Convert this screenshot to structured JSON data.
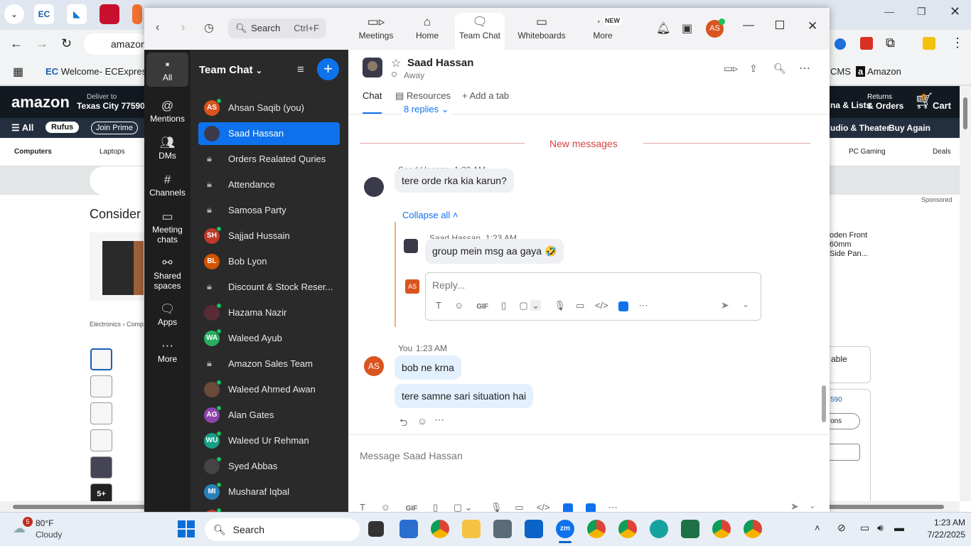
{
  "browser": {
    "address": "amazon",
    "bookmarks": {
      "first": "Welcome- ECExpres",
      "cms": "CMS",
      "amazon": "Amazon"
    },
    "amazon": {
      "logo": "amazon",
      "deliver_line1": "Deliver to",
      "deliver_line2": "Texas City 77590",
      "lists": "na & Lists",
      "returns_l1": "Returns",
      "returns_l2": "& Orders",
      "cart_count": "0",
      "cart": "Cart",
      "all": "All",
      "rufus": "Rufus",
      "join_prime": "Join Prime",
      "audio": "udio & Theater",
      "buy_again": "Buy Again",
      "cat_computers": "Computers",
      "cat_laptops": "Laptops",
      "cat_pcgaming": "PC Gaming",
      "cat_deals": "Deals",
      "consider": "Consider",
      "breadcrumb": "Electronics › Comp",
      "sponsored": "Sponsored",
      "side_prod": "oden Front\n60mm\nSide Pan...",
      "table_text": "able",
      "price_frag": "590",
      "ons": "ons",
      "more_thumbs": "5+"
    }
  },
  "zoom": {
    "search_placeholder": "Search",
    "search_shortcut": "Ctrl+F",
    "nav": [
      {
        "label": "Meetings",
        "icon": "video-icon"
      },
      {
        "label": "Home",
        "icon": "home-icon"
      },
      {
        "label": "Team Chat",
        "icon": "chat-icon"
      },
      {
        "label": "Whiteboards",
        "icon": "whiteboard-icon"
      },
      {
        "label": "More",
        "icon": "more-icon"
      }
    ],
    "new_badge": "NEW",
    "profile_initials": "AS",
    "rail": [
      {
        "label": "All",
        "icon": "chat-bubble-icon"
      },
      {
        "label": "Mentions",
        "icon": "at-icon"
      },
      {
        "label": "DMs",
        "icon": "people-icon"
      },
      {
        "label": "Channels",
        "icon": "hash-icon"
      },
      {
        "label": "Meeting chats",
        "icon": "calendar-icon"
      },
      {
        "label": "Shared spaces",
        "icon": "share-icon"
      },
      {
        "label": "Apps",
        "icon": "apps-icon"
      },
      {
        "label": "More",
        "icon": "ellipsis-icon"
      }
    ],
    "list_title": "Team Chat",
    "contacts": [
      {
        "name": "Ahsan Saqib (you)",
        "initials": "AS",
        "color": "#d9541e",
        "type": "avatar"
      },
      {
        "name": "Saad Hassan",
        "initials": "",
        "color": "#3a3a4a",
        "type": "photo"
      },
      {
        "name": "Orders Realated Quries",
        "type": "lock"
      },
      {
        "name": "Attendance",
        "type": "lock"
      },
      {
        "name": "Samosa Party",
        "type": "lock"
      },
      {
        "name": "Sajjad Hussain",
        "initials": "SH",
        "color": "#c0392b",
        "type": "avatar"
      },
      {
        "name": "Bob Lyon",
        "initials": "BL",
        "color": "#d35400",
        "type": "avatar"
      },
      {
        "name": "Discount & Stock Reser...",
        "type": "lock"
      },
      {
        "name": "Hazama Nazir",
        "initials": "",
        "color": "#5a2a35",
        "type": "photo"
      },
      {
        "name": "Waleed Ayub",
        "initials": "WA",
        "color": "#27ae60",
        "type": "avatar"
      },
      {
        "name": "Amazon Sales Team",
        "type": "lock"
      },
      {
        "name": "Waleed Ahmed Awan",
        "initials": "",
        "color": "#6b4a3a",
        "type": "photo"
      },
      {
        "name": "Alan Gates",
        "initials": "AG",
        "color": "#8e44ad",
        "type": "avatar"
      },
      {
        "name": "Waleed Ur Rehman",
        "initials": "WU",
        "color": "#16a085",
        "type": "avatar"
      },
      {
        "name": "Syed Abbas",
        "initials": "",
        "color": "#444",
        "type": "photo"
      },
      {
        "name": "Musharaf Iqbal",
        "initials": "MI",
        "color": "#2980b9",
        "type": "avatar"
      },
      {
        "name": "Imran Khan",
        "initials": "IK",
        "color": "#c0392b",
        "type": "avatar"
      }
    ],
    "chat": {
      "contact_name": "Saad Hassan",
      "status": "Away",
      "tabs": {
        "chat": "Chat",
        "resources": "Resources",
        "add": "Add a tab"
      },
      "replies": "8 replies",
      "new_messages": "New messages",
      "msg1": {
        "sender": "Saad Hassan",
        "time": "1:22 AM",
        "text": "tere orde rka kia karun?"
      },
      "collapse": "Collapse all",
      "reply1": {
        "sender": "Saad Hassan",
        "time": "1:23 AM",
        "text": "group mein msg aa gaya 🤣"
      },
      "reply_placeholder": "Reply...",
      "my_initials": "AS",
      "msg2": {
        "sender": "You",
        "time": "1:23 AM",
        "texts": [
          "bob ne krna",
          "tere samne sari situation hai"
        ]
      },
      "compose_placeholder": "Message Saad Hassan"
    }
  },
  "taskbar": {
    "weather_badge": "5",
    "temp": "80°F",
    "condition": "Cloudy",
    "search": "Search",
    "time": "1:23 AM",
    "date": "7/22/2025"
  }
}
